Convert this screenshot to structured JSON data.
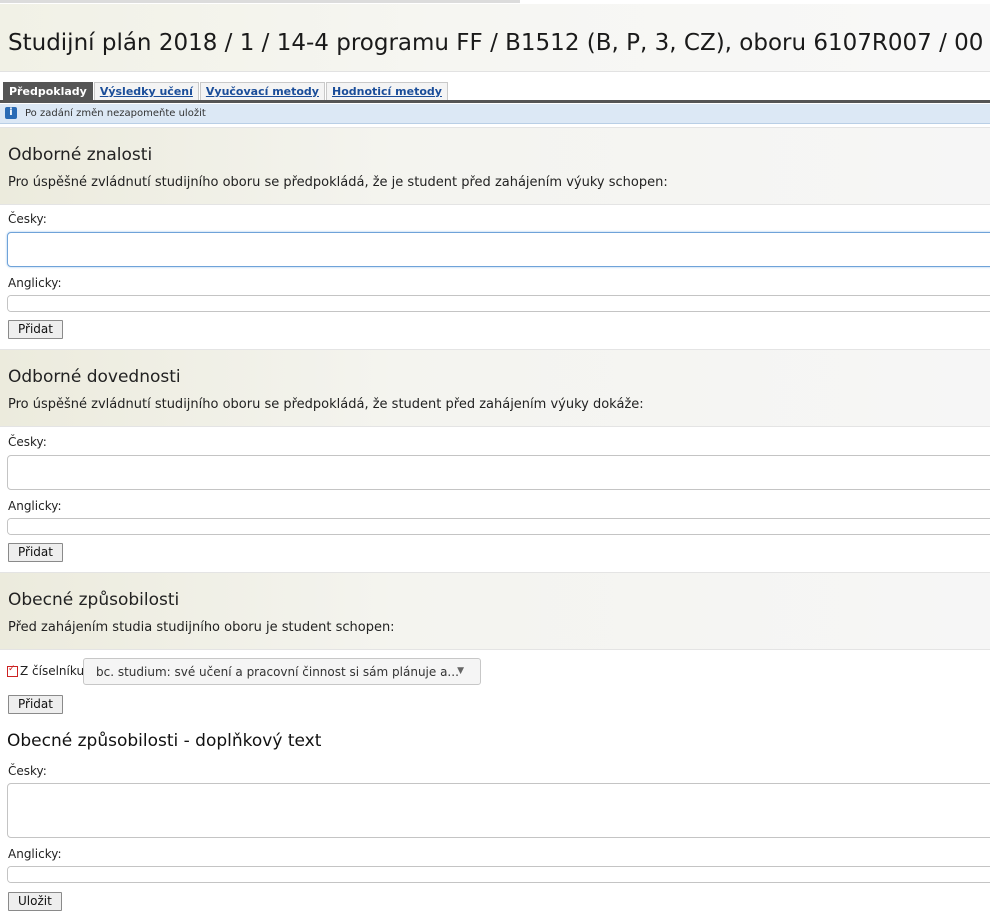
{
  "page": {
    "title": "Studijní plán 2018 / 1 / 14-4 programu FF / B1512 (B, P, 3, CZ), oboru 6107R007 / 00"
  },
  "tabs": [
    {
      "label": "Předpoklady"
    },
    {
      "label": "Výsledky učení"
    },
    {
      "label": "Vyučovací metody"
    },
    {
      "label": "Hodnoticí metody"
    }
  ],
  "info": {
    "text": "Po zadání změn nezapomeňte uložit"
  },
  "sections": [
    {
      "title": "Odborné znalosti",
      "description": "Pro úspěšné zvládnutí studijního oboru se předpokládá, že je student před zahájením výuky schopen:",
      "czech_label": "Česky:",
      "czech_value": "",
      "english_label": "Anglicky:",
      "english_value": "",
      "add_label": "Přidat"
    },
    {
      "title": "Odborné dovednosti",
      "description": "Pro úspěšné zvládnutí studijního oboru se předpokládá, že student před zahájením výuky dokáže:",
      "czech_label": "Česky:",
      "czech_value": "",
      "english_label": "Anglicky:",
      "english_value": "",
      "add_label": "Přidat"
    },
    {
      "title": "Obecné způsobilosti",
      "description": "Před zahájením studia studijního oboru je student schopen:",
      "checkbox_label": "Z číselníku",
      "checkbox_checked": true,
      "select_value": "bc. studium: své učení a pracovní činnost si sám plánuje a...",
      "add_label": "Přidat"
    }
  ],
  "supplement": {
    "title": "Obecné způsobilosti - doplňkový text",
    "czech_label": "Česky:",
    "czech_value": "",
    "english_label": "Anglicky:",
    "english_value": "",
    "save_label": "Uložit"
  },
  "icons": {
    "info": "info-icon",
    "dropdown": "chevron-down-icon",
    "checkbox": "checkbox-icon"
  }
}
